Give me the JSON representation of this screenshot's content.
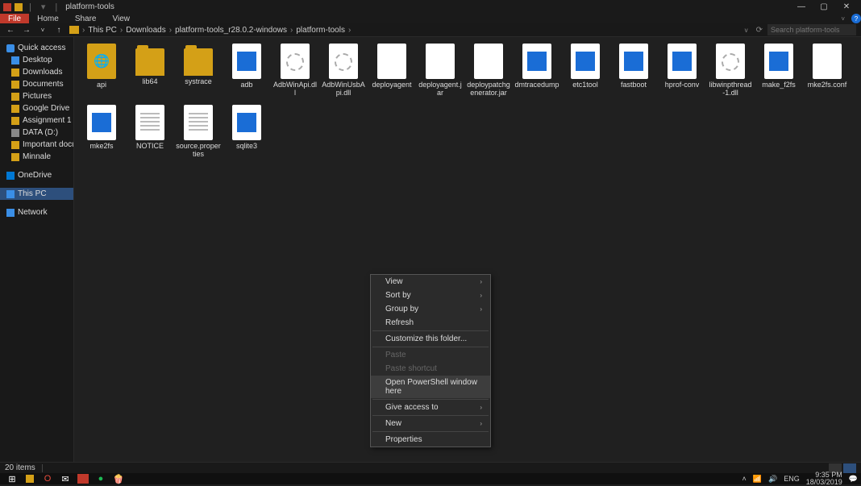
{
  "window": {
    "title": "platform-tools",
    "min": "—",
    "max": "▢",
    "close": "✕",
    "help": "?"
  },
  "ribbon": {
    "file": "File",
    "tabs": [
      "Home",
      "Share",
      "View"
    ]
  },
  "nav": {
    "back": "←",
    "forward": "→",
    "up": "↑",
    "chevdown": "˅",
    "refresh": "⟳",
    "dropdown": "v"
  },
  "breadcrumb": {
    "items": [
      "This PC",
      "Downloads",
      "platform-tools_r28.0.2-windows",
      "platform-tools"
    ],
    "sep": "›"
  },
  "search": {
    "placeholder": "Search platform-tools"
  },
  "sidebar": {
    "quick_access": "Quick access",
    "items": [
      {
        "label": "Desktop",
        "icon": "ic-desktop"
      },
      {
        "label": "Downloads",
        "icon": "ic-folder"
      },
      {
        "label": "Documents",
        "icon": "ic-folder"
      },
      {
        "label": "Pictures",
        "icon": "ic-folder"
      },
      {
        "label": "Google Drive",
        "icon": "ic-folder"
      },
      {
        "label": "Assignment 1",
        "icon": "ic-folder"
      },
      {
        "label": "DATA (D:)",
        "icon": "ic-drive"
      },
      {
        "label": "Important documen",
        "icon": "ic-folder"
      },
      {
        "label": "Minnale",
        "icon": "ic-folder"
      }
    ],
    "onedrive": "OneDrive",
    "this_pc": "This PC",
    "network": "Network"
  },
  "files": [
    {
      "name": "api",
      "type": "api-folder"
    },
    {
      "name": "lib64",
      "type": "folder"
    },
    {
      "name": "systrace",
      "type": "folder"
    },
    {
      "name": "adb",
      "type": "exe-blue"
    },
    {
      "name": "AdbWinApi.dll",
      "type": "dll"
    },
    {
      "name": "AdbWinUsbApi.dll",
      "type": "dll"
    },
    {
      "name": "deployagent",
      "type": "blank"
    },
    {
      "name": "deployagent.jar",
      "type": "blank"
    },
    {
      "name": "deploypatchgenerator.jar",
      "type": "blank"
    },
    {
      "name": "dmtracedump",
      "type": "exe-blue"
    },
    {
      "name": "etc1tool",
      "type": "exe-blue"
    },
    {
      "name": "fastboot",
      "type": "exe-blue"
    },
    {
      "name": "hprof-conv",
      "type": "exe-blue"
    },
    {
      "name": "libwinpthread-1.dll",
      "type": "dll"
    },
    {
      "name": "make_f2fs",
      "type": "exe-blue"
    },
    {
      "name": "mke2fs.conf",
      "type": "blank"
    },
    {
      "name": "mke2fs",
      "type": "exe-blue"
    },
    {
      "name": "NOTICE",
      "type": "text"
    },
    {
      "name": "source.properties",
      "type": "text"
    },
    {
      "name": "sqlite3",
      "type": "exe-blue"
    }
  ],
  "context_menu": {
    "items": [
      {
        "label": "View",
        "submenu": true
      },
      {
        "label": "Sort by",
        "submenu": true
      },
      {
        "label": "Group by",
        "submenu": true
      },
      {
        "label": "Refresh"
      },
      {
        "sep": true
      },
      {
        "label": "Customize this folder..."
      },
      {
        "sep": true
      },
      {
        "label": "Paste",
        "disabled": true
      },
      {
        "label": "Paste shortcut",
        "disabled": true
      },
      {
        "label": "Open PowerShell window here",
        "highlighted": true
      },
      {
        "sep": true
      },
      {
        "label": "Give access to",
        "submenu": true
      },
      {
        "sep": true
      },
      {
        "label": "New",
        "submenu": true
      },
      {
        "sep": true
      },
      {
        "label": "Properties"
      }
    ],
    "arrow": "›"
  },
  "statusbar": {
    "count": "20 items"
  },
  "taskbar": {
    "start": "⊞",
    "tray": {
      "up": "˄",
      "wifi": "📶",
      "sound": "🔊",
      "lang": "ENG",
      "time": "9:35 PM",
      "date": "18/03/2019",
      "notif": "💬"
    }
  }
}
